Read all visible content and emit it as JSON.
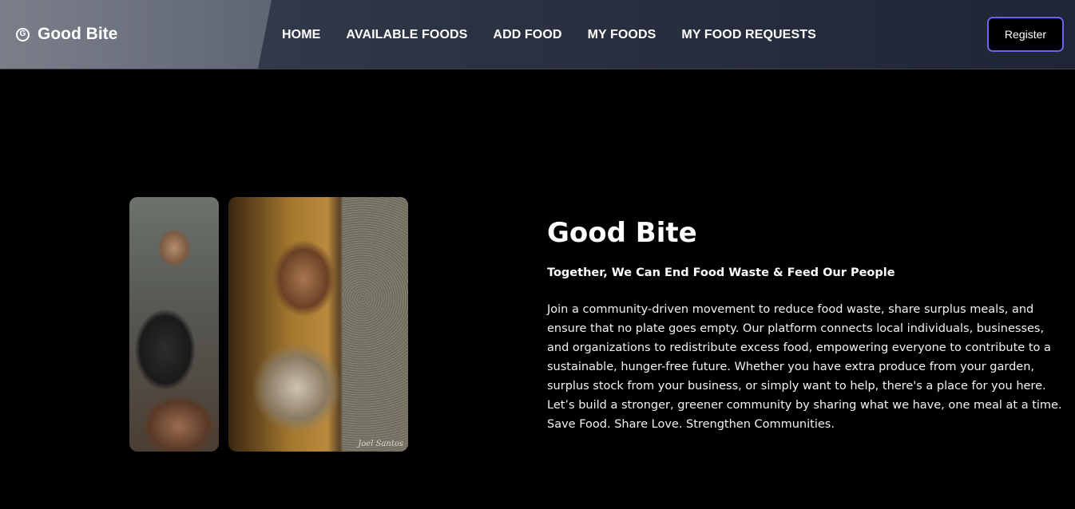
{
  "navbar": {
    "brand_icon_glyph": "G",
    "brand_name": "Good Bite",
    "links": [
      "HOME",
      "AVAILABLE FOODS",
      "ADD FOOD",
      "MY FOODS",
      "MY FOOD REQUESTS"
    ],
    "register_label": "Register",
    "accent_color": "#6b62f0"
  },
  "hero": {
    "title": "Good Bite",
    "subtitle": "Together, We Can End Food Waste & Feed Our People",
    "body": "Join a community-driven movement to reduce food waste, share surplus meals, and ensure that no plate goes empty. Our platform connects local individuals, businesses, and organizations to redistribute excess food, empowering everyone to contribute to a sustainable, hunger-free future. Whether you have extra produce from your garden, surplus stock from your business, or simply want to help, there's a place for you here. Let’s build a stronger, greener community by sharing what we have, one meal at a time. Save Food. Share Love. Strengthen Communities.",
    "images": [
      {
        "name": "child-with-bowls-photo"
      },
      {
        "name": "child-behind-pillar-photo",
        "signature": "Joel Santos"
      }
    ]
  }
}
